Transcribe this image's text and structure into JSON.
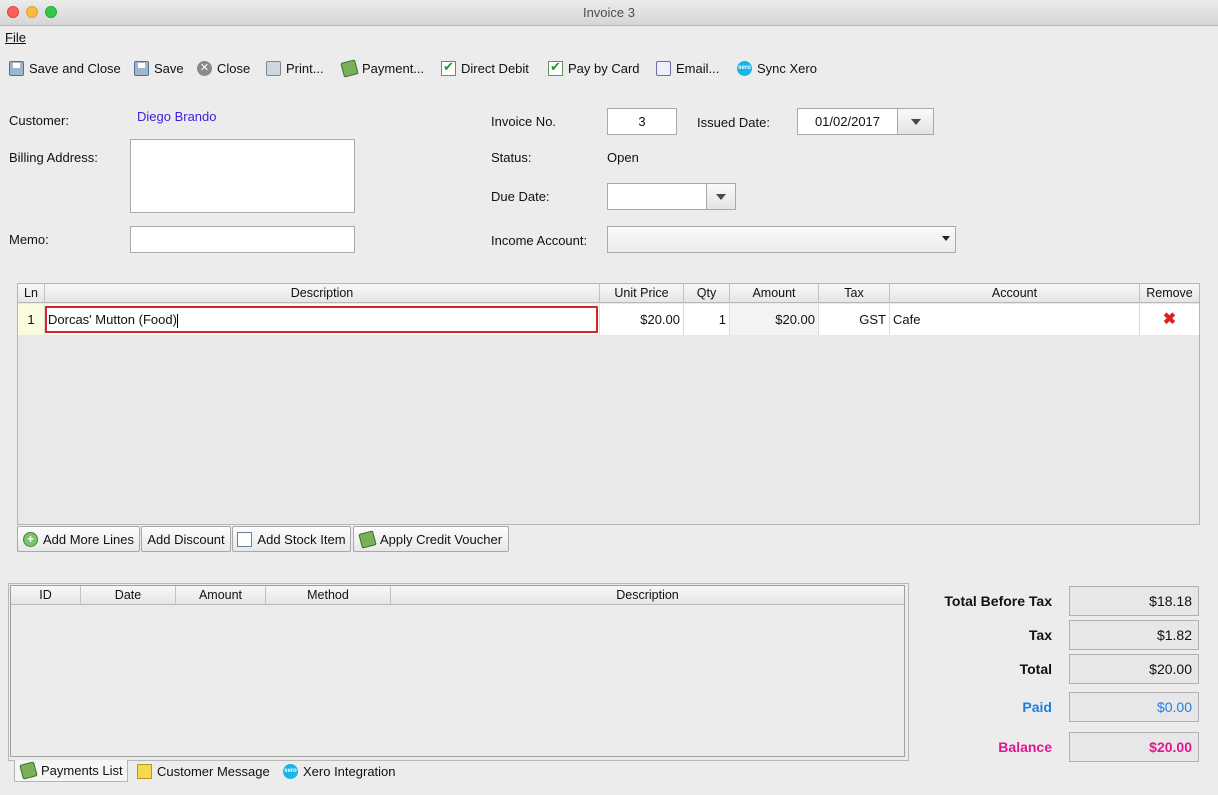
{
  "window": {
    "title": "Invoice 3"
  },
  "menu": {
    "file": "File"
  },
  "toolbar": {
    "save_close": "Save and Close",
    "save": "Save",
    "close": "Close",
    "print": "Print...",
    "payment": "Payment...",
    "direct_debit": "Direct Debit",
    "pay_by_card": "Pay by Card",
    "email": "Email...",
    "sync_xero": "Sync Xero"
  },
  "form": {
    "customer_label": "Customer:",
    "customer_value": "Diego Brando",
    "billing_label": "Billing Address:",
    "billing_value": "",
    "memo_label": "Memo:",
    "memo_value": "",
    "invoice_no_label": "Invoice No.",
    "invoice_no_value": "3",
    "issued_date_label": "Issued Date:",
    "issued_date_value": "01/02/2017",
    "status_label": "Status:",
    "status_value": "Open",
    "due_date_label": "Due Date:",
    "due_date_value": "",
    "income_account_label": "Income Account:",
    "income_account_value": ""
  },
  "lines": {
    "columns": [
      "Ln",
      "Description",
      "Unit Price",
      "Qty",
      "Amount",
      "Tax",
      "Account",
      "Remove"
    ],
    "rows": [
      {
        "ln": "1",
        "description": "Dorcas' Mutton (Food)",
        "unit_price": "$20.00",
        "qty": "1",
        "amount": "$20.00",
        "tax": "GST",
        "account": "Cafe"
      }
    ]
  },
  "line_buttons": {
    "add_more": "Add More Lines",
    "add_discount": "Add Discount",
    "add_stock": "Add Stock Item",
    "apply_voucher": "Apply Credit Voucher"
  },
  "payments": {
    "columns": [
      "ID",
      "Date",
      "Amount",
      "Method",
      "Description"
    ]
  },
  "totals": {
    "before_tax_label": "Total Before Tax",
    "before_tax_value": "$18.18",
    "tax_label": "Tax",
    "tax_value": "$1.82",
    "total_label": "Total",
    "total_value": "$20.00",
    "paid_label": "Paid",
    "paid_value": "$0.00",
    "balance_label": "Balance",
    "balance_value": "$20.00",
    "paid_color": "#1e7fe0",
    "balance_color": "#e0188c"
  },
  "tabs": {
    "payments_list": "Payments List",
    "customer_message": "Customer Message",
    "xero_integration": "Xero Integration"
  }
}
